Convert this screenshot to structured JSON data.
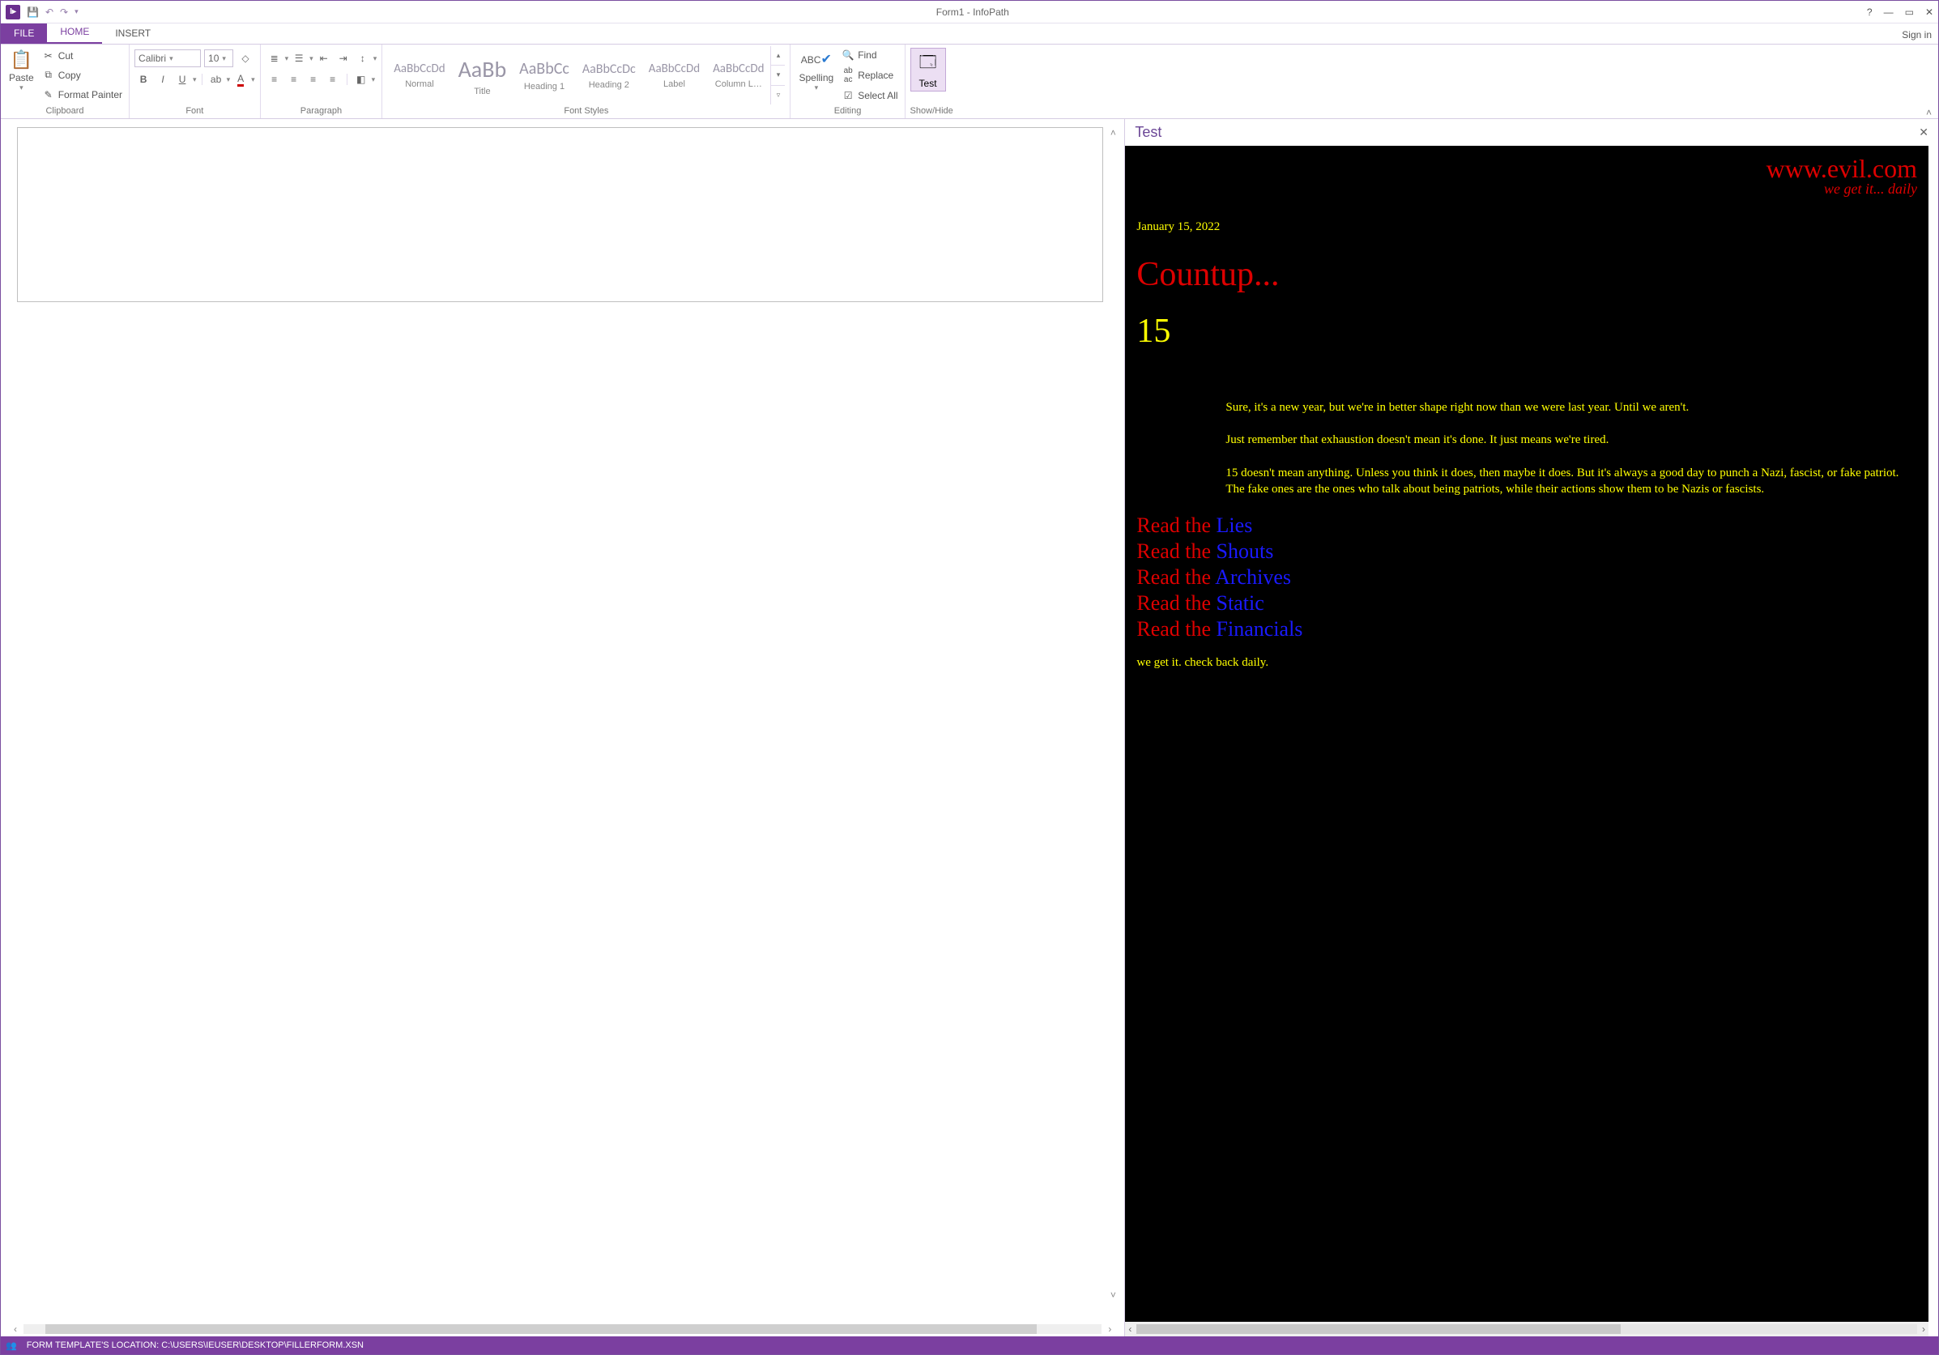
{
  "window": {
    "title": "Form1 - InfoPath"
  },
  "tabs": {
    "file": "FILE",
    "home": "HOME",
    "insert": "INSERT",
    "signin": "Sign in"
  },
  "clipboard": {
    "paste": "Paste",
    "cut": "Cut",
    "copy": "Copy",
    "format_painter": "Format Painter",
    "label": "Clipboard"
  },
  "font": {
    "name": "Calibri",
    "size": "10",
    "label": "Font"
  },
  "paragraph": {
    "label": "Paragraph"
  },
  "fontstyles": {
    "label": "Font Styles",
    "items": [
      {
        "sample": "AaBbCcDd",
        "caption": "Normal",
        "size": "15px"
      },
      {
        "sample": "AaBb",
        "caption": "Title",
        "size": "28px"
      },
      {
        "sample": "AaBbCc",
        "caption": "Heading 1",
        "size": "20px"
      },
      {
        "sample": "AaBbCcDc",
        "caption": "Heading 2",
        "size": "16px"
      },
      {
        "sample": "AaBbCcDd",
        "caption": "Label",
        "size": "15px"
      },
      {
        "sample": "AaBbCcDd",
        "caption": "Column L…",
        "size": "15px"
      }
    ]
  },
  "editing": {
    "label": "Editing",
    "spelling": "Spelling",
    "find": "Find",
    "replace": "Replace",
    "selectall": "Select All"
  },
  "showhide": {
    "label": "Show/Hide",
    "test": "Test"
  },
  "pane": {
    "title": "Test"
  },
  "preview": {
    "site": "www.evil.com",
    "tag": "we get it... daily",
    "date": "January 15, 2022",
    "countup": "Countup...",
    "number": "15",
    "p1": "Sure, it's a new year, but we're in better shape right now than we were last year. Until we aren't.",
    "p2": "Just remember that exhaustion doesn't mean it's done. It just means we're tired.",
    "p3": "15 doesn't mean anything. Unless you think it does, then maybe it does. But it's always a good day to punch a Nazi, fascist, or fake patriot. The fake ones are the ones who talk about being patriots, while their actions show them to be Nazis or fascists.",
    "read_prefix": "Read the ",
    "links": [
      "Lies",
      "Shouts",
      "Archives",
      "Static",
      "Financials"
    ],
    "footer": "we get it.  check back daily."
  },
  "status": {
    "location": "FORM TEMPLATE'S LOCATION:  C:\\USERS\\IEUSER\\DESKTOP\\FILLERFORM.XSN"
  }
}
